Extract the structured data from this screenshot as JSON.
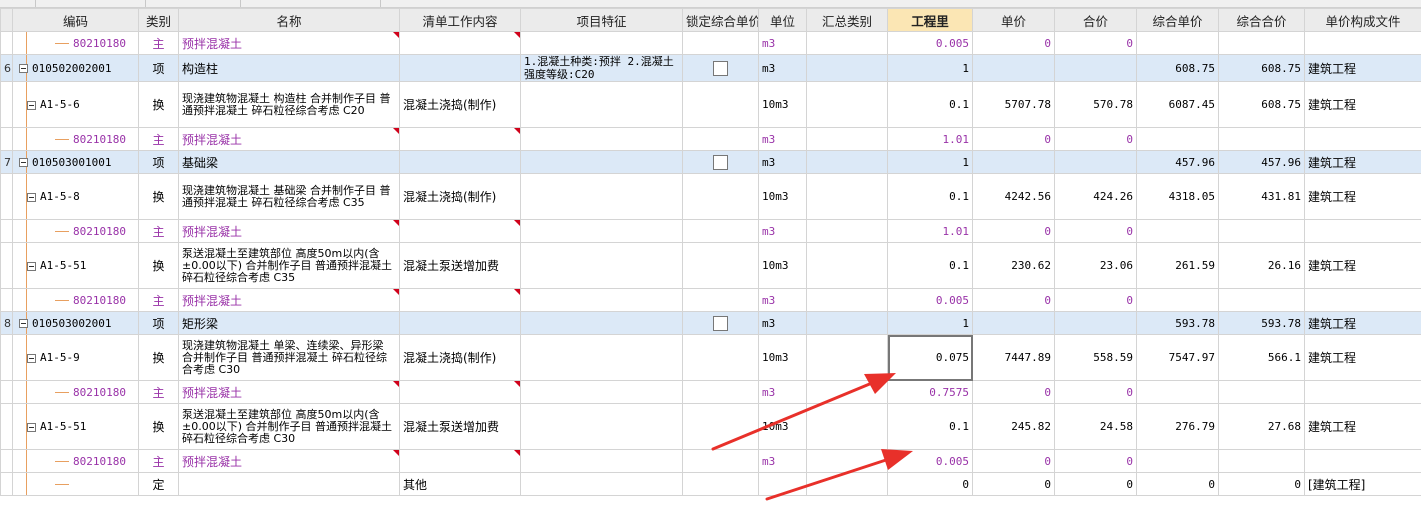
{
  "columns": {
    "gutter": "",
    "code": "编码",
    "type": "类别",
    "name": "名称",
    "content": "清单工作内容",
    "feature": "项目特征",
    "lock": "锁定综合单价",
    "unit": "单位",
    "summary": "汇总类别",
    "qty": "工程里",
    "price": "单价",
    "total": "合价",
    "uprice": "综合单价",
    "utotal": "综合合价",
    "file": "单价构成文件"
  },
  "rows": [
    {
      "gutter": "",
      "code": "80210180",
      "type": "主",
      "name": "预拌混凝土",
      "content": "",
      "feature": "",
      "lock": "",
      "unit": "m3",
      "summary": "",
      "qty": "0.005",
      "price": "0",
      "total": "0",
      "uprice": "",
      "utotal": "",
      "file": ""
    },
    {
      "gutter": "6",
      "code": "010502002001",
      "type": "项",
      "name": "构造柱",
      "content": "",
      "feature": "1.混凝土种类:预拌\n2.混凝土强度等级:C20",
      "lock": "",
      "unit": "m3",
      "summary": "",
      "qty": "1",
      "price": "",
      "total": "",
      "uprice": "608.75",
      "utotal": "608.75",
      "file": "建筑工程"
    },
    {
      "gutter": "",
      "code": "A1-5-6",
      "type": "换",
      "name": "现浇建筑物混凝土 构造柱 合并制作子目 普通预拌混凝土 碎石粒径综合考虑 C20",
      "content": "混凝土浇捣(制作)",
      "feature": "",
      "lock": "",
      "unit": "10m3",
      "summary": "",
      "qty": "0.1",
      "price": "5707.78",
      "total": "570.78",
      "uprice": "6087.45",
      "utotal": "608.75",
      "file": "建筑工程"
    },
    {
      "gutter": "",
      "code": "80210180",
      "type": "主",
      "name": "预拌混凝土",
      "content": "",
      "feature": "",
      "lock": "",
      "unit": "m3",
      "summary": "",
      "qty": "1.01",
      "price": "0",
      "total": "0",
      "uprice": "",
      "utotal": "",
      "file": ""
    },
    {
      "gutter": "7",
      "code": "010503001001",
      "type": "项",
      "name": "基础梁",
      "content": "",
      "feature": "",
      "lock": "",
      "unit": "m3",
      "summary": "",
      "qty": "1",
      "price": "",
      "total": "",
      "uprice": "457.96",
      "utotal": "457.96",
      "file": "建筑工程"
    },
    {
      "gutter": "",
      "code": "A1-5-8",
      "type": "换",
      "name": "现浇建筑物混凝土 基础梁 合并制作子目 普通预拌混凝土 碎石粒径综合考虑 C35",
      "content": "混凝土浇捣(制作)",
      "feature": "",
      "lock": "",
      "unit": "10m3",
      "summary": "",
      "qty": "0.1",
      "price": "4242.56",
      "total": "424.26",
      "uprice": "4318.05",
      "utotal": "431.81",
      "file": "建筑工程"
    },
    {
      "gutter": "",
      "code": "80210180",
      "type": "主",
      "name": "预拌混凝土",
      "content": "",
      "feature": "",
      "lock": "",
      "unit": "m3",
      "summary": "",
      "qty": "1.01",
      "price": "0",
      "total": "0",
      "uprice": "",
      "utotal": "",
      "file": ""
    },
    {
      "gutter": "",
      "code": "A1-5-51",
      "type": "换",
      "name": "泵送混凝土至建筑部位 高度50m以内(含±0.00以下) 合并制作子目 普通预拌混凝土 碎石粒径综合考虑 C35",
      "content": "混凝土泵送增加费",
      "feature": "",
      "lock": "",
      "unit": "10m3",
      "summary": "",
      "qty": "0.1",
      "price": "230.62",
      "total": "23.06",
      "uprice": "261.59",
      "utotal": "26.16",
      "file": "建筑工程"
    },
    {
      "gutter": "",
      "code": "80210180",
      "type": "主",
      "name": "预拌混凝土",
      "content": "",
      "feature": "",
      "lock": "",
      "unit": "m3",
      "summary": "",
      "qty": "0.005",
      "price": "0",
      "total": "0",
      "uprice": "",
      "utotal": "",
      "file": ""
    },
    {
      "gutter": "8",
      "code": "010503002001",
      "type": "项",
      "name": "矩形梁",
      "content": "",
      "feature": "",
      "lock": "",
      "unit": "m3",
      "summary": "",
      "qty": "1",
      "price": "",
      "total": "",
      "uprice": "593.78",
      "utotal": "593.78",
      "file": "建筑工程"
    },
    {
      "gutter": "",
      "code": "A1-5-9",
      "type": "换",
      "name": "现浇建筑物混凝土 单梁、连续梁、异形梁 合并制作子目 普通预拌混凝土 碎石粒径综合考虑 C30",
      "content": "混凝土浇捣(制作)",
      "feature": "",
      "lock": "",
      "unit": "10m3",
      "summary": "",
      "qty": "0.075",
      "price": "7447.89",
      "total": "558.59",
      "uprice": "7547.97",
      "utotal": "566.1",
      "file": "建筑工程"
    },
    {
      "gutter": "",
      "code": "80210180",
      "type": "主",
      "name": "预拌混凝土",
      "content": "",
      "feature": "",
      "lock": "",
      "unit": "m3",
      "summary": "",
      "qty": "0.7575",
      "price": "0",
      "total": "0",
      "uprice": "",
      "utotal": "",
      "file": ""
    },
    {
      "gutter": "",
      "code": "A1-5-51",
      "type": "换",
      "name": "泵送混凝土至建筑部位 高度50m以内(含±0.00以下) 合并制作子目 普通预拌混凝土 碎石粒径综合考虑 C30",
      "content": "混凝土泵送增加费",
      "feature": "",
      "lock": "",
      "unit": "10m3",
      "summary": "",
      "qty": "0.1",
      "price": "245.82",
      "total": "24.58",
      "uprice": "276.79",
      "utotal": "27.68",
      "file": "建筑工程"
    },
    {
      "gutter": "",
      "code": "80210180",
      "type": "主",
      "name": "预拌混凝土",
      "content": "",
      "feature": "",
      "lock": "",
      "unit": "m3",
      "summary": "",
      "qty": "0.005",
      "price": "0",
      "total": "0",
      "uprice": "",
      "utotal": "",
      "file": ""
    },
    {
      "gutter": "",
      "code": "",
      "type": "定",
      "name": "",
      "content": "其他",
      "feature": "",
      "lock": "",
      "unit": "",
      "summary": "",
      "qty": "0",
      "price": "0",
      "total": "0",
      "uprice": "0",
      "utotal": "0",
      "file": "[建筑工程]"
    }
  ],
  "colors": {
    "bill_row": "#dce9f7",
    "material_text": "#9932a8",
    "arrow": "#e8302a",
    "qty_header": "#fbe6b4"
  }
}
